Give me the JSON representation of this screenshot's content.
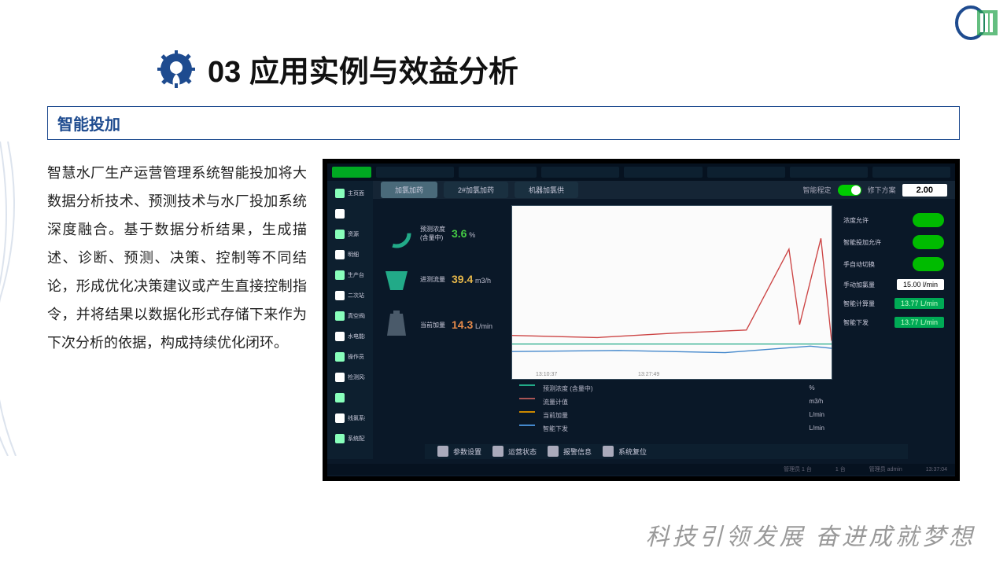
{
  "header": {
    "section_number": "03",
    "section_title": "应用实例与效益分析"
  },
  "subsection": {
    "label": "智能投加"
  },
  "body": {
    "paragraph": "智慧水厂生产运营管理系统智能投加将大数据分析技术、预测技术与水厂投加系统深度融合。基于数据分析结果，生成描 述、诊断、预测、决策、控制等不同结论，形成优化决策建议或产生直接控制指令，并将结果以数据化形式存储下来作为下次分析的依据，构成持续优化闭环。"
  },
  "screenshot": {
    "nav": [
      "主页面",
      "",
      "资源",
      "明细",
      "生产台",
      "二次站",
      "真空阀门",
      "水电能耗",
      "操作员",
      "检测风机",
      "",
      "线氯系统",
      "系统配置"
    ],
    "tabs": [
      "加氯加药",
      "2#加氯加药",
      "机器加氯供"
    ],
    "top_right": {
      "label_a": "智能程定",
      "label_b": "修下方案",
      "value": "2.00"
    },
    "metrics": [
      {
        "label": "预测浓度",
        "sub": "(含量中)",
        "value": "3.6",
        "unit": "%",
        "color": "v-green",
        "icon": "ring"
      },
      {
        "label": "进测流量",
        "value": "39.4",
        "unit": "m3/h",
        "color": "v-yellow",
        "icon": "trapezoid"
      },
      {
        "label": "当前加量",
        "value": "14.3",
        "unit": "L/min",
        "color": "v-orange",
        "icon": "weight"
      }
    ],
    "chart_times": [
      "13:10:37",
      "13:27:49"
    ],
    "legend": [
      {
        "color": "#2a8",
        "label": "预测浓度 (含量中)",
        "unit": "%"
      },
      {
        "color": "#a55",
        "label": "流量计值",
        "unit": "m3/h"
      },
      {
        "color": "#c80",
        "label": "当前加量",
        "unit": "L/min"
      },
      {
        "color": "#48c",
        "label": "智能下发",
        "unit": "L/min"
      }
    ],
    "controls": [
      {
        "label": "浓度允许",
        "type": "toggle"
      },
      {
        "label": "智能投加允许",
        "type": "toggle"
      },
      {
        "label": "手自动切换",
        "type": "toggle"
      },
      {
        "label": "手动加氯量",
        "value": "15.00",
        "unit": "l/min",
        "type": "value"
      },
      {
        "label": "智能计算量",
        "value": "13.77",
        "unit": "L/min",
        "type": "green"
      },
      {
        "label": "智能下发",
        "value": "13.77",
        "unit": "L/min",
        "type": "green"
      }
    ],
    "bottom_bar": [
      "参数设置",
      "运营状态",
      "报警信息",
      "系统复位"
    ],
    "footer": [
      "管理员 1 台",
      "1 台",
      "管理员 admin",
      "13:37:04"
    ]
  },
  "slogan": "科技引领发展 奋进成就梦想",
  "colors": {
    "primary": "#1e4b8f",
    "accent": "#22a34a"
  }
}
